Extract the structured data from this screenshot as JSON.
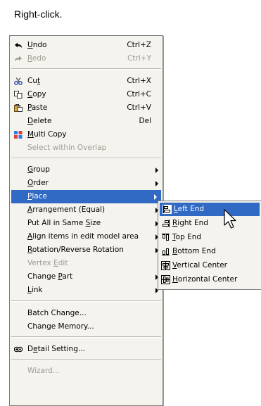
{
  "caption": "Right-click.",
  "menu": {
    "items": [
      {
        "pre": "",
        "acc": "U",
        "post": "ndo",
        "shortcut": "Ctrl+Z",
        "icon": "undo-icon"
      },
      {
        "pre": "",
        "acc": "R",
        "post": "edo",
        "shortcut": "Ctrl+Y",
        "icon": "redo-icon"
      },
      {
        "pre": "Cu",
        "acc": "t",
        "post": "",
        "shortcut": "Ctrl+X",
        "icon": "scissors-icon"
      },
      {
        "pre": "",
        "acc": "C",
        "post": "opy",
        "shortcut": "Ctrl+C",
        "icon": "copy-icon"
      },
      {
        "pre": "",
        "acc": "P",
        "post": "aste",
        "shortcut": "Ctrl+V",
        "icon": "paste-icon"
      },
      {
        "pre": "",
        "acc": "D",
        "post": "elete",
        "shortcut": "Del"
      },
      {
        "pre": "",
        "acc": "M",
        "post": "ulti Copy",
        "icon": "multi-copy-icon"
      },
      {
        "label": "Select within Overlap"
      },
      {
        "pre": "",
        "acc": "G",
        "post": "roup"
      },
      {
        "pre": "",
        "acc": "O",
        "post": "rder"
      },
      {
        "pre": "",
        "acc": "P",
        "post": "lace"
      },
      {
        "pre": "",
        "acc": "A",
        "post": "rrangement (Equal)"
      },
      {
        "pre": "Put All in Same ",
        "acc": "S",
        "post": "ize"
      },
      {
        "pre": "",
        "acc": "A",
        "post": "lign items in edit model area"
      },
      {
        "pre": "",
        "acc": "R",
        "post": "otation/Reverse Rotation"
      },
      {
        "pre": "Vertex ",
        "acc": "E",
        "post": "dit"
      },
      {
        "pre": "Change ",
        "acc": "P",
        "post": "art"
      },
      {
        "pre": "",
        "acc": "L",
        "post": "ink"
      },
      {
        "label": "Batch Change..."
      },
      {
        "label": "Change Memory..."
      },
      {
        "pre": "D",
        "acc": "e",
        "post": "tail Setting...",
        "icon": "detail-setting-icon"
      },
      {
        "label": "Wizard..."
      }
    ]
  },
  "submenu": {
    "items": [
      {
        "acc": "L",
        "post": "eft End",
        "icon": "left-end-icon"
      },
      {
        "acc": "R",
        "post": "ight End",
        "icon": "right-end-icon"
      },
      {
        "acc": "T",
        "post": "op End",
        "icon": "top-end-icon"
      },
      {
        "acc": "B",
        "post": "ottom End",
        "icon": "bottom-end-icon"
      },
      {
        "acc": "V",
        "post": "ertical Center",
        "icon": "vertical-center-icon"
      },
      {
        "acc": "H",
        "post": "orizontal Center",
        "icon": "horizontal-center-icon"
      }
    ]
  },
  "colors": {
    "highlight": "#316ac5",
    "menu_bg": "#f4f3ee",
    "disabled": "#9c9c95"
  }
}
